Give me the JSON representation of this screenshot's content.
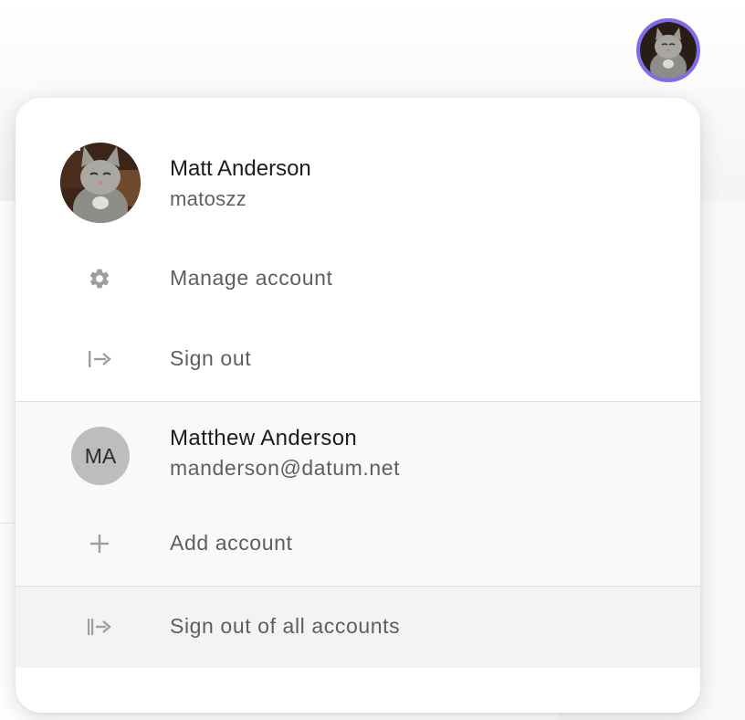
{
  "primary_account": {
    "name": "Matt Anderson",
    "username": "matoszz",
    "avatar_icon": "cat-photo-avatar"
  },
  "menu": {
    "manage_account": "Manage account",
    "manage_icon": "gear-icon",
    "sign_out": "Sign out",
    "sign_out_icon": "sign-out-icon"
  },
  "secondary_account": {
    "initials": "MA",
    "name": "Matthew Anderson",
    "email": "manderson@datum.net"
  },
  "add_account": {
    "label": "Add account",
    "icon": "plus-icon"
  },
  "sign_out_all": {
    "label": "Sign out of all accounts",
    "icon": "sign-out-all-icon"
  },
  "colors": {
    "avatar_ring": "#7b6cf0",
    "initials_avatar_bg": "#bdbdbd",
    "icon_gray": "#9e9e9e"
  }
}
